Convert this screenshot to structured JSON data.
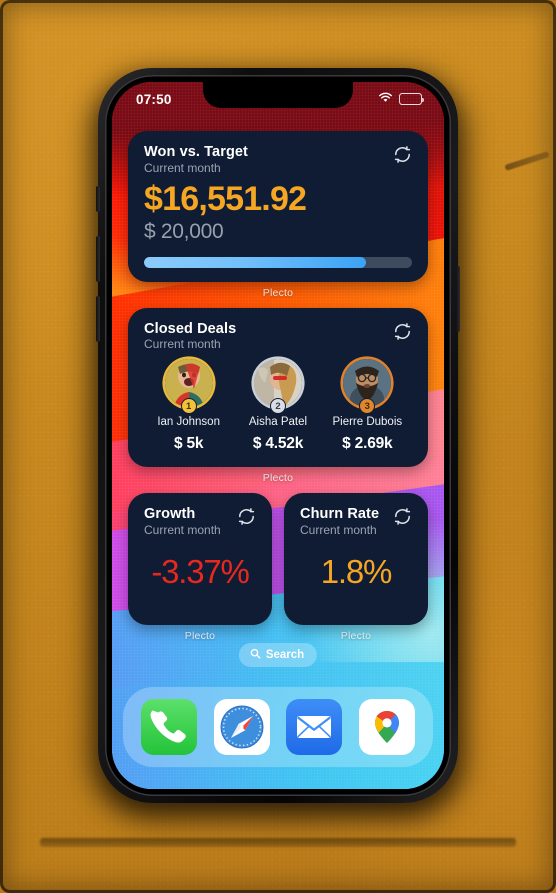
{
  "scene": {
    "surface": "cardboard-desk",
    "surface_color": "#c98a20",
    "device": "smartphone"
  },
  "status_bar": {
    "time": "07:50",
    "wifi_icon": "wifi-icon",
    "battery_icon": "battery-full-icon"
  },
  "widgets": [
    {
      "title": "Won vs. Target",
      "subtitle": "Current month",
      "refresh_icon": "refresh-icon",
      "value": "$16,551.92",
      "target": "$ 20,000",
      "progress_percent": 82.8,
      "value_color": "#f5a623",
      "progress_color": "#4fa9f5",
      "footer": "Plecto"
    },
    {
      "title": "Closed Deals",
      "subtitle": "Current month",
      "refresh_icon": "refresh-icon",
      "footer": "Plecto",
      "leaders": [
        {
          "rank": "1",
          "name": "Ian Johnson",
          "value": "$ 5k",
          "medal": "gold"
        },
        {
          "rank": "2",
          "name": "Aisha Patel",
          "value": "$ 4.52k",
          "medal": "silver"
        },
        {
          "rank": "3",
          "name": "Pierre Dubois",
          "value": "$ 2.69k",
          "medal": "bronze"
        }
      ]
    },
    {
      "title": "Growth",
      "subtitle": "Current month",
      "refresh_icon": "refresh-icon",
      "value": "-3.37%",
      "value_color": "#e8281f",
      "footer": "Plecto"
    },
    {
      "title": "Churn Rate",
      "subtitle": "Current month",
      "refresh_icon": "refresh-icon",
      "value": "1.8%",
      "value_color": "#f5a623",
      "footer": "Plecto"
    }
  ],
  "search": {
    "label": "Search",
    "icon": "search-icon"
  },
  "dock": {
    "apps": [
      {
        "name": "phone-app",
        "label": "Phone"
      },
      {
        "name": "safari-app",
        "label": "Safari"
      },
      {
        "name": "mail-app",
        "label": "Mail"
      },
      {
        "name": "maps-app",
        "label": "Maps"
      }
    ]
  }
}
